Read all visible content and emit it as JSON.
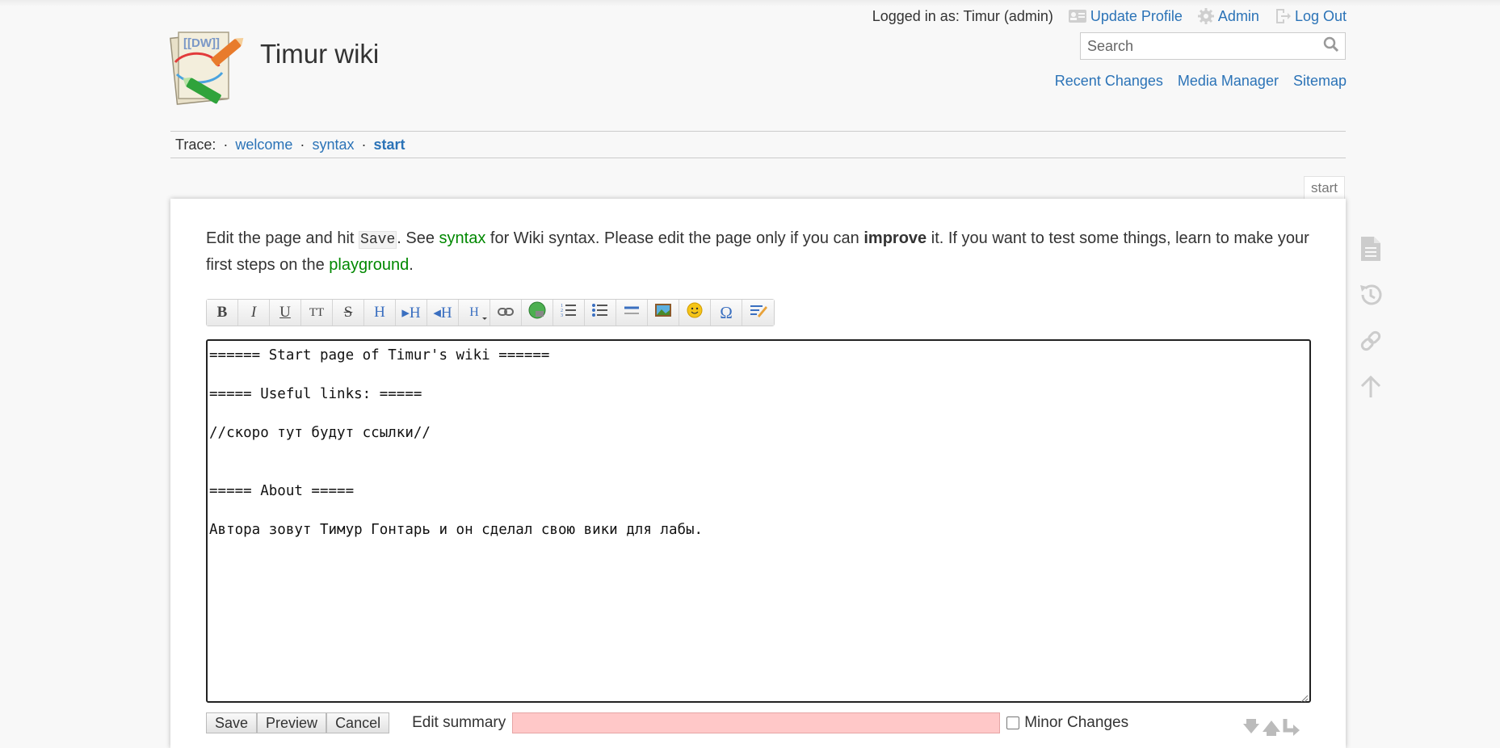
{
  "header": {
    "logged_in_label": "Logged in as: Timur (admin)",
    "update_profile": "Update Profile",
    "admin": "Admin",
    "logout": "Log Out",
    "site_title": "Timur wiki",
    "logo_text": "[[DW]]",
    "search_placeholder": "Search",
    "site_tools": [
      "Recent Changes",
      "Media Manager",
      "Sitemap"
    ]
  },
  "trace": {
    "label": "Trace:",
    "crumbs": [
      "welcome",
      "syntax"
    ],
    "current": "start"
  },
  "page_tab": "start",
  "intro": {
    "t1": "Edit the page and hit ",
    "save_code": "Save",
    "t2": ". See ",
    "syntax_link": "syntax",
    "t3": " for Wiki syntax. Please edit the page only if you can ",
    "improve": "improve",
    "t4": " it. If you want to test some things, learn to make your first steps on the ",
    "playground_link": "playground",
    "t5": "."
  },
  "toolbar": {
    "buttons": [
      "bold",
      "italic",
      "underline",
      "monospace",
      "strikethrough",
      "heading-same",
      "heading-lower",
      "heading-higher",
      "heading-select",
      "link",
      "external-link",
      "ordered-list",
      "unordered-list",
      "horizontal-rule",
      "media",
      "smileys",
      "special-chars",
      "signature"
    ]
  },
  "editor": {
    "content": "====== Start page of Timur's wiki ======\n\n===== Useful links: =====\n\n//скоро тут будут ссылки//\n\n\n===== About =====\n\nАвтора зовут Тимур Гонтарь и он сделал свою вики для лабы."
  },
  "bottom": {
    "save": "Save",
    "preview": "Preview",
    "cancel": "Cancel",
    "summary_label": "Edit summary",
    "minor_label": "Minor Changes"
  },
  "colors": {
    "link": "#2b73b7",
    "wiki_link": "#008800",
    "summary_bg": "#ffc8c8"
  }
}
